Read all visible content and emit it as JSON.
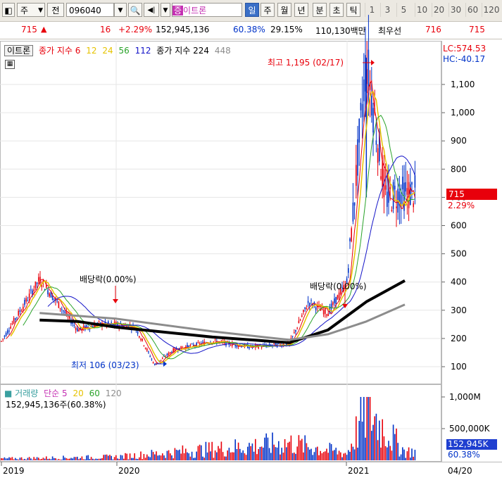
{
  "toolbar": {
    "market": "주",
    "kind": "전",
    "code": "096040",
    "name": "이트론",
    "name_prefix": "증",
    "period_active": "일",
    "periods": [
      "주",
      "월",
      "년",
      "분",
      "초",
      "틱"
    ],
    "numbers": [
      "1",
      "3",
      "5",
      "10",
      "20",
      "30",
      "60",
      "120"
    ]
  },
  "quote": {
    "price": "715",
    "change": "16",
    "change_pct": "+2.29%",
    "volume": "152,945,136",
    "volume_ratio": "60.38%",
    "turnover": "29.15%",
    "value": "110,130백만",
    "quote_label": "최우선",
    "ask": "716",
    "bid": "715"
  },
  "legend": {
    "name": "이트론",
    "ma_label": "종가 지수",
    "ma_periods": [
      "6",
      "12",
      "24",
      "56",
      "112"
    ],
    "ma2_label": "종가 지수",
    "ma2_periods": [
      "224",
      "448"
    ],
    "lc": "LC:574.53",
    "hc": "HC:-40.17"
  },
  "annotations": {
    "high": "최고 1,195 (02/17)",
    "low": "최저 106 (03/23)",
    "div1": "배당락(0.00%)",
    "div2": "배당락(0.00%)"
  },
  "price_tag": {
    "value": "715",
    "pct": "2.29%"
  },
  "volume_legend": {
    "label": "거래량",
    "ma_label": "단순",
    "periods": [
      "5",
      "20",
      "60",
      "120"
    ],
    "value": "152,945,136주(60.38%)"
  },
  "volume_tag": "152,945K",
  "volume_pct": "60.38%",
  "colors": {
    "up": "#e8000b",
    "down": "#0032c8",
    "ma6": "#e8000b",
    "ma12": "#e6c300",
    "ma24": "#2aa32a",
    "ma56": "#1414c8",
    "ma112": "#000000",
    "ma224": "#000000",
    "ma448": "#8c8c8c"
  },
  "chart_data": [
    {
      "type": "line",
      "title": "",
      "y_ticks": [
        100,
        200,
        300,
        400,
        500,
        600,
        700,
        800,
        900,
        1000,
        1100
      ],
      "y_ticks_labels": [
        "100",
        "200",
        "300",
        "400",
        "500",
        "600",
        "700",
        "800",
        "900",
        "1,000",
        "1,100"
      ],
      "ylim": [
        60,
        1210
      ],
      "x_ticks": [
        "2019",
        "2020",
        "2021",
        "04/20"
      ],
      "series": [
        {
          "name": "종가",
          "x": [
            "2019-01",
            "2019-03",
            "2019-05",
            "2019-07",
            "2019-09",
            "2019-11",
            "2020-01",
            "2020-02",
            "2020-03",
            "2020-04",
            "2020-06",
            "2020-08",
            "2020-10",
            "2020-11",
            "2020-12",
            "2021-01",
            "2021-02",
            "2021-03",
            "2021-04"
          ],
          "values": [
            190,
            300,
            410,
            320,
            230,
            250,
            250,
            240,
            106,
            160,
            190,
            170,
            180,
            330,
            290,
            400,
            1195,
            700,
            715
          ]
        },
        {
          "name": "112",
          "x": [
            "2019-05",
            "2019-09",
            "2020-01",
            "2020-06",
            "2020-10",
            "2020-12",
            "2021-02",
            "2021-04"
          ],
          "values": [
            265,
            260,
            240,
            205,
            185,
            230,
            330,
            405
          ]
        },
        {
          "name": "224",
          "x": [
            "2019-05",
            "2019-09",
            "2020-01",
            "2020-06",
            "2020-10",
            "2020-12",
            "2021-02",
            "2021-04"
          ],
          "values": [
            290,
            280,
            270,
            225,
            195,
            215,
            260,
            320
          ]
        }
      ]
    },
    {
      "type": "bar",
      "title": "",
      "y_ticks_labels": [
        "1,000M",
        "500,000K"
      ],
      "y_ticks": [
        1000000,
        500000
      ],
      "series": [
        {
          "name": "거래량",
          "x": [
            "2019",
            "2020",
            "2020-10",
            "2021-01",
            "2021-02",
            "2021-04"
          ],
          "values": [
            30000,
            60000,
            300000,
            120000,
            900000,
            152945
          ]
        }
      ]
    }
  ]
}
